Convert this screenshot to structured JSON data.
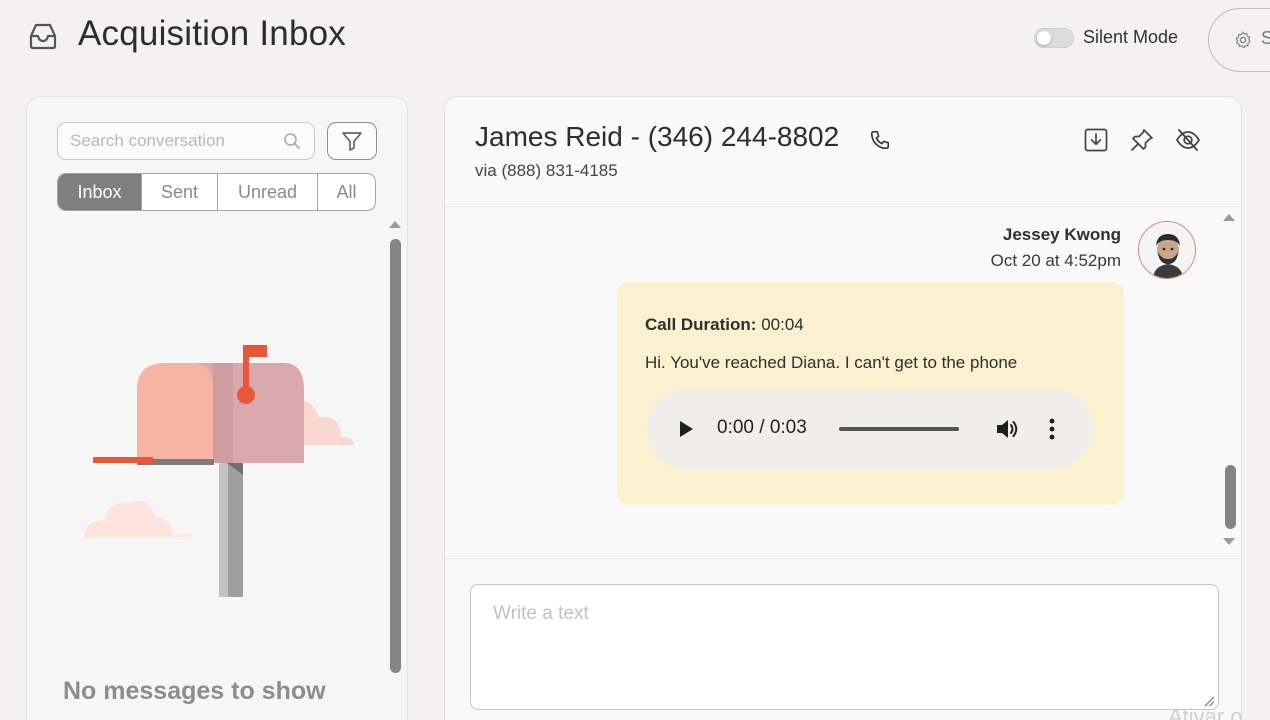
{
  "header": {
    "title": "Acquisition Inbox",
    "silent_mode_label": "Silent Mode",
    "silent_mode_on": false,
    "settings_label": "S"
  },
  "left_panel": {
    "search_placeholder": "Search conversation",
    "tabs": [
      {
        "label": "Inbox",
        "active": true
      },
      {
        "label": "Sent",
        "active": false
      },
      {
        "label": "Unread",
        "active": false
      },
      {
        "label": "All",
        "active": false
      }
    ],
    "empty_message": "No messages to show"
  },
  "conversation": {
    "contact_title": "James Reid - (346) 244-8802",
    "via": "via (888) 831-4185",
    "message": {
      "sender": "Jessey Kwong",
      "timestamp": "Oct 20 at 4:52pm",
      "call_duration_label": "Call Duration:",
      "call_duration_value": "00:04",
      "transcript": "Hi. You've reached Diana. I can't get to the phone",
      "audio": {
        "time": "0:00 / 0:03",
        "progress": 1.0
      }
    },
    "compose_placeholder": "Write a text"
  },
  "watermark": "Ativar o",
  "colors": {
    "bubble": "#fbf0cf",
    "accent": "#e8573b",
    "active_tab": "#7f7f7f"
  }
}
